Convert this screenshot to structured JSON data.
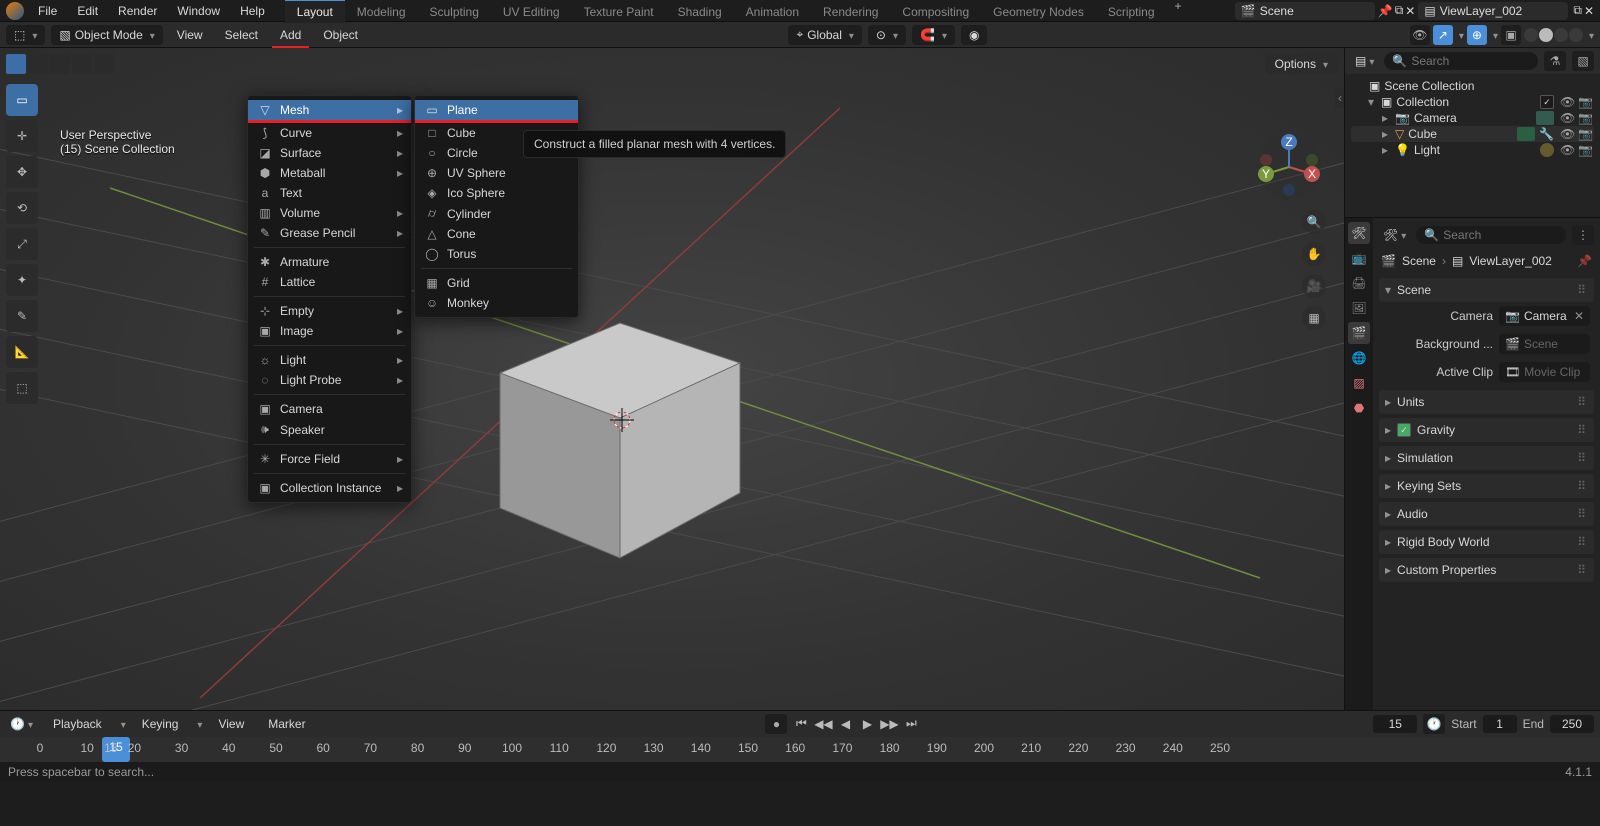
{
  "top_menu": {
    "file": "File",
    "edit": "Edit",
    "render": "Render",
    "window": "Window",
    "help": "Help"
  },
  "workspaces": [
    "Layout",
    "Modeling",
    "Sculpting",
    "UV Editing",
    "Texture Paint",
    "Shading",
    "Animation",
    "Rendering",
    "Compositing",
    "Geometry Nodes",
    "Scripting"
  ],
  "active_workspace": "Layout",
  "scene_name": "Scene",
  "view_layer": "ViewLayer_002",
  "header": {
    "mode": "Object Mode",
    "menus": {
      "view": "View",
      "select": "Select",
      "add": "Add",
      "object": "Object"
    },
    "orientation": "Global",
    "options": "Options"
  },
  "viewport_info": {
    "line1": "User Perspective",
    "line2": "(15) Scene Collection"
  },
  "add_menu": {
    "items": [
      {
        "label": "Mesh",
        "sub": true,
        "hi": true,
        "icon": "▽"
      },
      {
        "label": "Curve",
        "sub": true,
        "icon": "⟆"
      },
      {
        "label": "Surface",
        "sub": true,
        "icon": "◪"
      },
      {
        "label": "Metaball",
        "sub": true,
        "icon": "⬢"
      },
      {
        "label": "Text",
        "icon": "a"
      },
      {
        "label": "Volume",
        "sub": true,
        "icon": "▥"
      },
      {
        "label": "Grease Pencil",
        "sub": true,
        "icon": "✎"
      },
      {
        "sep": true
      },
      {
        "label": "Armature",
        "icon": "✱"
      },
      {
        "label": "Lattice",
        "icon": "#"
      },
      {
        "sep": true
      },
      {
        "label": "Empty",
        "sub": true,
        "icon": "⊹"
      },
      {
        "label": "Image",
        "sub": true,
        "icon": "▣"
      },
      {
        "sep": true
      },
      {
        "label": "Light",
        "sub": true,
        "icon": "☼"
      },
      {
        "label": "Light Probe",
        "sub": true,
        "icon": "◌"
      },
      {
        "sep": true
      },
      {
        "label": "Camera",
        "icon": "▣"
      },
      {
        "label": "Speaker",
        "icon": "🕪"
      },
      {
        "sep": true
      },
      {
        "label": "Force Field",
        "sub": true,
        "icon": "✳"
      },
      {
        "sep": true
      },
      {
        "label": "Collection Instance",
        "sub": true,
        "icon": "▣"
      }
    ]
  },
  "mesh_menu": {
    "items": [
      {
        "label": "Plane",
        "hi": true,
        "icon": "▭"
      },
      {
        "label": "Cube",
        "icon": "□"
      },
      {
        "label": "Circle",
        "icon": "○"
      },
      {
        "label": "UV Sphere",
        "icon": "⊕"
      },
      {
        "label": "Ico Sphere",
        "icon": "◈"
      },
      {
        "label": "Cylinder",
        "icon": "⌭"
      },
      {
        "label": "Cone",
        "icon": "△"
      },
      {
        "label": "Torus",
        "icon": "◯"
      },
      {
        "sep": true
      },
      {
        "label": "Grid",
        "icon": "▦"
      },
      {
        "label": "Monkey",
        "icon": "☺"
      }
    ]
  },
  "tooltip": "Construct a filled planar mesh with 4 vertices.",
  "gizmo": {
    "x": "X",
    "y": "Y",
    "z": "Z"
  },
  "outliner": {
    "search_placeholder": "Search",
    "root": "Scene Collection",
    "collection": "Collection",
    "items": [
      {
        "name": "Camera",
        "type": "camera"
      },
      {
        "name": "Cube",
        "type": "mesh"
      },
      {
        "name": "Light",
        "type": "light"
      }
    ]
  },
  "properties": {
    "search_placeholder": "Search",
    "breadcrumb_scene": "Scene",
    "breadcrumb_vl": "ViewLayer_002",
    "scene_panel": "Scene",
    "camera_lbl": "Camera",
    "camera_val": "Camera",
    "bg_lbl": "Background ...",
    "bg_placeholder": "Scene",
    "clip_lbl": "Active Clip",
    "clip_placeholder": "Movie Clip",
    "panels": [
      "Units",
      "Gravity",
      "Simulation",
      "Keying Sets",
      "Audio",
      "Rigid Body World",
      "Custom Properties"
    ],
    "gravity_checked": true
  },
  "timeline": {
    "playback": "Playback",
    "keying": "Keying",
    "view": "View",
    "marker": "Marker",
    "current": "15",
    "start_lbl": "Start",
    "start": "1",
    "end_lbl": "End",
    "end": "250",
    "ticks": [
      0,
      10,
      15,
      20,
      30,
      40,
      50,
      60,
      70,
      80,
      90,
      100,
      110,
      120,
      130,
      140,
      150,
      160,
      170,
      180,
      190,
      200,
      210,
      220,
      230,
      240,
      250
    ],
    "playhead": "15"
  },
  "status": {
    "left": "Press spacebar to search...",
    "right": "4.1.1"
  }
}
